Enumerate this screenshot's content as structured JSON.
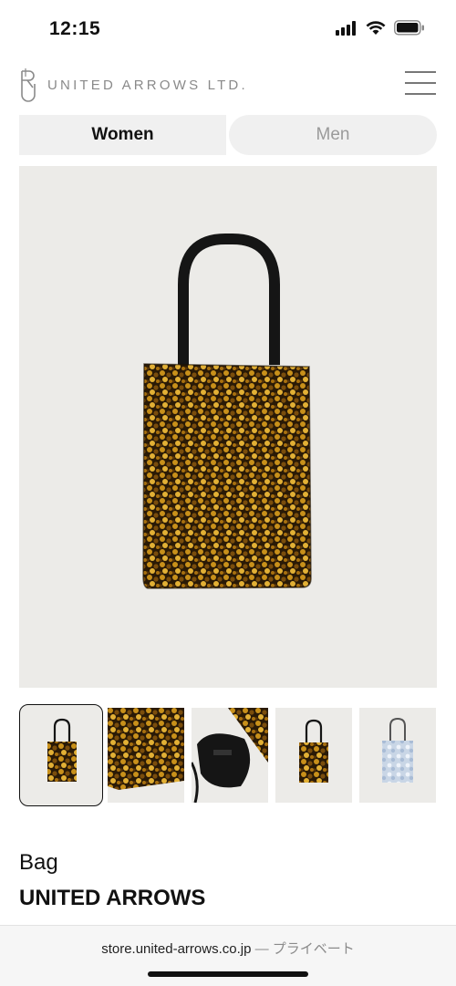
{
  "status_bar": {
    "time": "12:15"
  },
  "header": {
    "brand_text": "UNITED ARROWS LTD."
  },
  "tabs": [
    {
      "label": "Women",
      "selected": true
    },
    {
      "label": "Men",
      "selected": false
    }
  ],
  "product": {
    "category": "Bag",
    "brand": "UNITED ARROWS",
    "gallery": [
      {
        "icon": "gold-sequin-tote-thumbnail",
        "selected": true
      },
      {
        "icon": "sequin-closeup-thumbnail",
        "selected": false
      },
      {
        "icon": "bag-interior-thumbnail",
        "selected": false
      },
      {
        "icon": "gold-sequin-tote-thumbnail",
        "selected": false
      },
      {
        "icon": "silver-sequin-tote-thumbnail",
        "selected": false
      }
    ]
  },
  "browser": {
    "domain": "store.united-arrows.co.jp",
    "mode": " — プライベート"
  },
  "colors": {
    "accent": "#111111",
    "muted": "#9a9a9a",
    "photo_bg": "#ecebe8"
  }
}
